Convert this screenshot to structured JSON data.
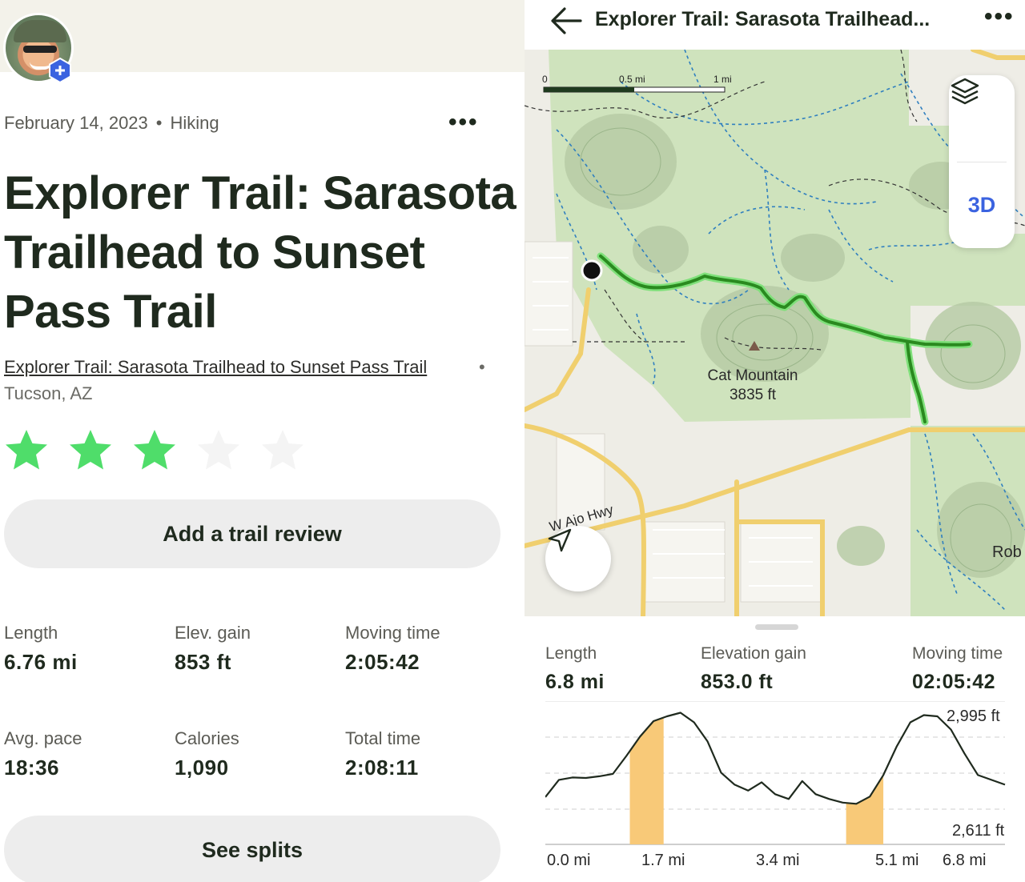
{
  "activity": {
    "date": "February 14, 2023",
    "type": "Hiking",
    "title": "Explorer Trail: Sarasota Trailhead to Sunset Pass Trail",
    "trail_link": "Explorer Trail: Sarasota Trailhead to Sunset Pass Trail",
    "separator": "•",
    "location": "Tucson, AZ",
    "rating": 3,
    "rating_max": 5,
    "add_review_label": "Add a trail review",
    "see_splits_label": "See splits"
  },
  "stats": [
    {
      "label": "Length",
      "value": "6.76 mi"
    },
    {
      "label": "Elev. gain",
      "value": "853 ft"
    },
    {
      "label": "Moving time",
      "value": "2:05:42"
    },
    {
      "label": "Avg. pace",
      "value": "18:36"
    },
    {
      "label": "Calories",
      "value": "1,090"
    },
    {
      "label": "Total time",
      "value": "2:08:11"
    }
  ],
  "map_view": {
    "header_title": "Explorer Trail: Sarasota Trailhead...",
    "layers_icon": "layers-icon",
    "mode_button": "3D",
    "scale": [
      "0",
      "0.5 mi",
      "1 mi"
    ],
    "peak_name": "Cat Mountain",
    "peak_elevation": "3835 ft",
    "road_label": "W Ajo Hwy",
    "edge_label": "Rob",
    "colors": {
      "park": "#cfe3bd",
      "route": "#2a8a1f",
      "route_glow": "#7fe07a",
      "road": "#f0cf6e",
      "trail": "#2f7fbf",
      "accent": "#3b63e0"
    }
  },
  "summary": [
    {
      "label": "Length",
      "value": "6.8 mi"
    },
    {
      "label": "Elevation gain",
      "value": "853.0 ft"
    },
    {
      "label": "Moving time",
      "value": "02:05:42"
    }
  ],
  "chart_data": {
    "type": "area",
    "x_labels": [
      "0.0 mi",
      "1.7 mi",
      "3.4 mi",
      "5.1 mi",
      "6.8 mi"
    ],
    "y_labels": [
      "2,995 ft",
      "2,611 ft"
    ],
    "x": [
      0.0,
      0.2,
      0.4,
      0.6,
      0.8,
      1.0,
      1.2,
      1.4,
      1.6,
      1.8,
      2.0,
      2.2,
      2.4,
      2.6,
      2.8,
      3.0,
      3.2,
      3.4,
      3.6,
      3.8,
      4.0,
      4.2,
      4.4,
      4.6,
      4.8,
      5.0,
      5.2,
      5.4,
      5.6,
      5.8,
      6.0,
      6.2,
      6.4,
      6.6,
      6.8
    ],
    "y": [
      2648,
      2720,
      2730,
      2728,
      2735,
      2745,
      2820,
      2900,
      2965,
      2985,
      3000,
      2960,
      2880,
      2750,
      2700,
      2675,
      2710,
      2660,
      2640,
      2715,
      2660,
      2640,
      2625,
      2620,
      2650,
      2740,
      2860,
      2960,
      2990,
      2985,
      2930,
      2830,
      2740,
      2720,
      2700
    ],
    "y_min_label_value": 2611,
    "y_max_label_value": 2995,
    "highlight_ranges_mi": [
      [
        1.25,
        1.75
      ],
      [
        4.45,
        5.0
      ]
    ],
    "highlight_color": "#f8c978",
    "line_color": "#1f2a1e"
  }
}
